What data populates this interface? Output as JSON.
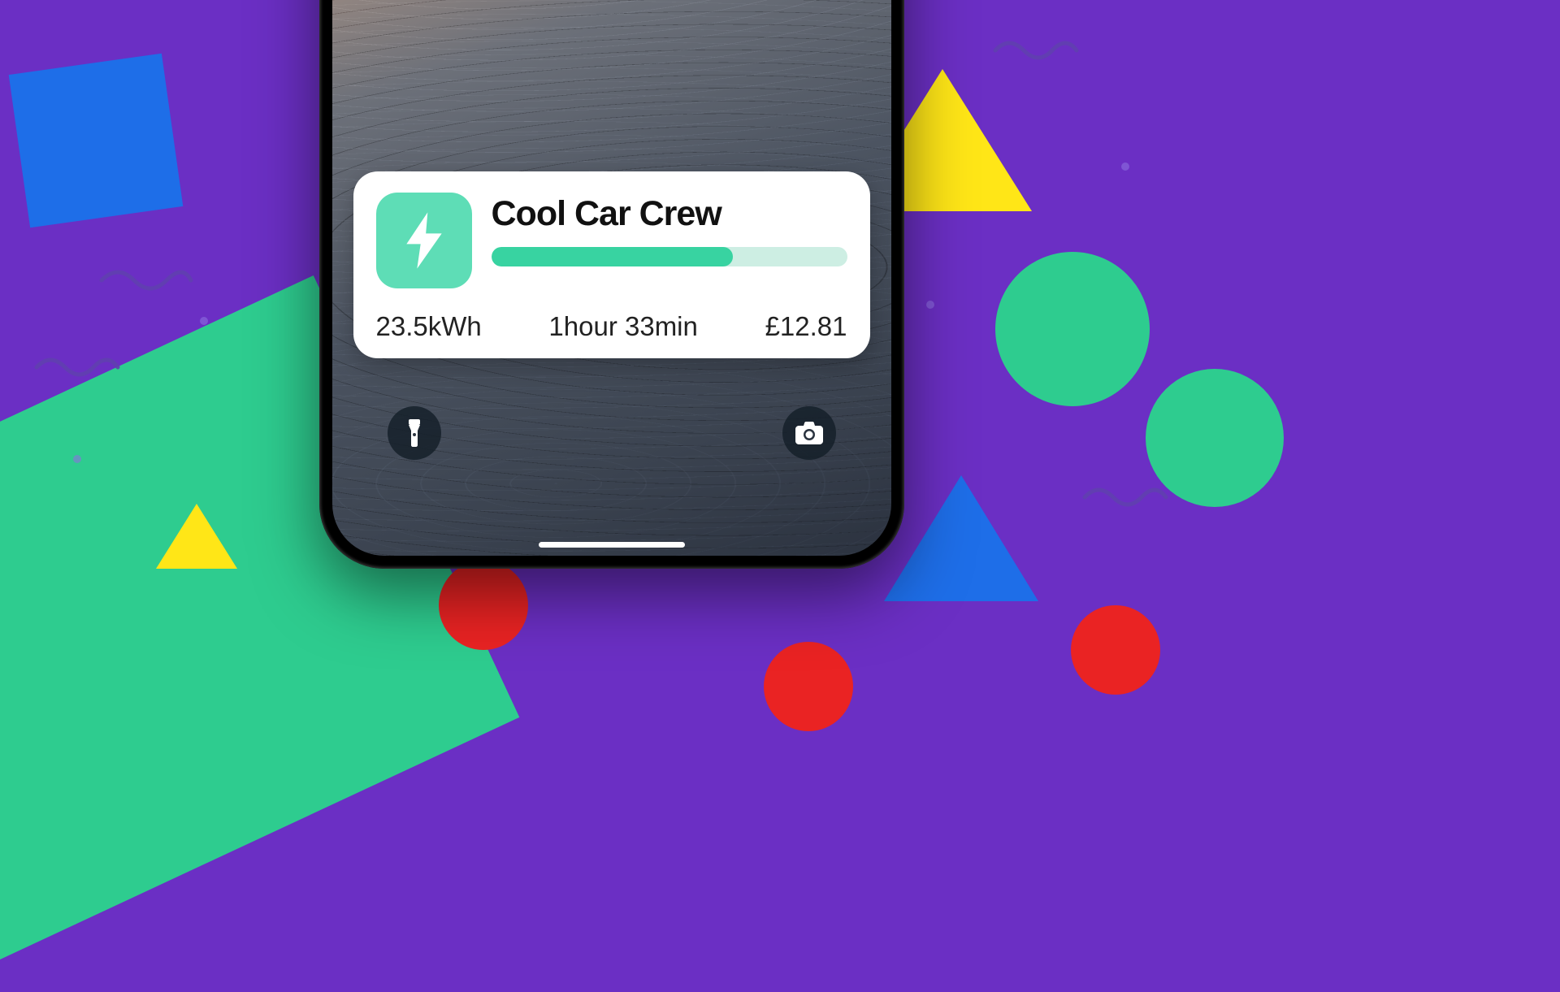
{
  "widget": {
    "title": "Cool Car Crew",
    "progress_percent": 68,
    "energy": "23.5kWh",
    "duration": "1hour 33min",
    "cost": "£12.81"
  },
  "lockscreen": {
    "flashlight_icon": "flashlight-icon",
    "camera_icon": "camera-icon",
    "home_indicator": "home-indicator"
  },
  "colors": {
    "bg": "#6B2FC4",
    "accent_green": "#38D3A1",
    "accent_green_light": "#5EDDB6",
    "blue": "#1E6EE8",
    "yellow": "#FFE617",
    "red": "#EA2323"
  }
}
